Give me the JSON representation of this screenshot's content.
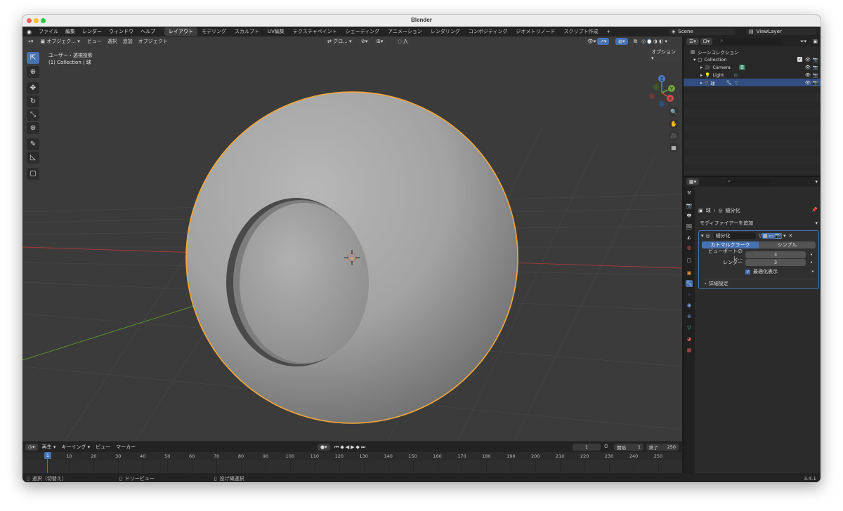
{
  "window": {
    "title": "Blender"
  },
  "menubar": {
    "items": [
      "ファイル",
      "編集",
      "レンダー",
      "ウィンドウ",
      "ヘルプ"
    ],
    "workspaces": [
      "レイアウト",
      "モデリング",
      "スカルプト",
      "UV編集",
      "テクスチャペイント",
      "シェーディング",
      "アニメーション",
      "レンダリング",
      "コンポジティング",
      "ジオメトリノード",
      "スクリプト作成"
    ],
    "add_tab": "+",
    "scene": "Scene",
    "view_layer": "ViewLayer"
  },
  "viewport": {
    "mode": "オブジェク...",
    "menus": [
      "ビュー",
      "選択",
      "追加",
      "オブジェクト"
    ],
    "transform_orientation": "グロ...",
    "options": "オプション",
    "overlay_title": "ユーザー・透視投影",
    "overlay_subtitle": "(1) Collection | 球",
    "gizmo": {
      "z": "Z",
      "y": "Y",
      "x": "X"
    }
  },
  "timeline": {
    "menus": [
      "再生",
      "キーイング",
      "ビュー",
      "マーカー"
    ],
    "current_frame": "1",
    "start_label": "開始",
    "start": "1",
    "end_label": "終了",
    "end": "250",
    "ticks": [
      "1",
      "10",
      "20",
      "30",
      "40",
      "50",
      "60",
      "70",
      "80",
      "90",
      "100",
      "110",
      "120",
      "130",
      "140",
      "150",
      "160",
      "170",
      "180",
      "190",
      "200",
      "210",
      "220",
      "230",
      "240",
      "250"
    ]
  },
  "statusbar": {
    "items": [
      "選択（切替え）",
      "ドリービュー",
      "投げ縄選択"
    ],
    "version": "3.4.1"
  },
  "outliner": {
    "root": "シーンコレクション",
    "collection": "Collection",
    "objects": [
      {
        "name": "Camera",
        "selected": false
      },
      {
        "name": "Light",
        "selected": false
      },
      {
        "name": "球",
        "selected": true
      }
    ]
  },
  "properties": {
    "breadcrumb_object": "球",
    "breadcrumb_modifier": "細分化",
    "add_modifier": "モディファイアーを追加",
    "modifier": {
      "name": "細分化",
      "type_active": "カトマルクラーク",
      "type_other": "シンプル",
      "viewport_label": "ビューポートのレ...",
      "viewport_value": "3",
      "render_label": "レンダー",
      "render_value": "3",
      "optimal_label": "最適化表示",
      "advanced_label": "詳細設定"
    }
  },
  "colors": {
    "selection_outline": "#f2a93b",
    "active_blue": "#4772b3",
    "x_axis": "#a83a3a",
    "y_axis": "#5d9a2f"
  }
}
